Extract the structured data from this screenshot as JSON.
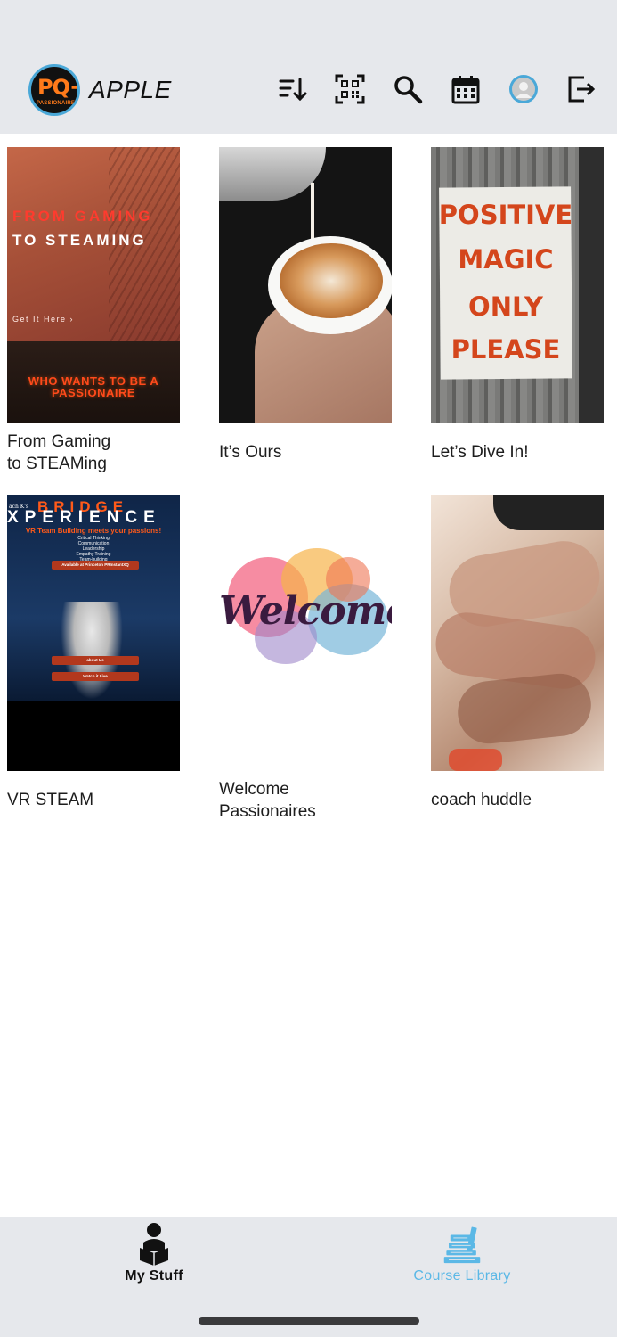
{
  "header": {
    "logo_text": "PQ+",
    "logo_subtext": "PASSIONAIRE",
    "brand": "APPLE",
    "actions": [
      {
        "name": "sort",
        "icon": "sort-descending-icon"
      },
      {
        "name": "qr",
        "icon": "qr-code-icon"
      },
      {
        "name": "search",
        "icon": "search-icon"
      },
      {
        "name": "calendar",
        "icon": "calendar-icon"
      },
      {
        "name": "profile",
        "icon": "avatar"
      },
      {
        "name": "logout",
        "icon": "logout-icon"
      }
    ]
  },
  "courses": [
    {
      "title": "From Gaming\nto STEAMing",
      "thumb": {
        "line1": "FROM GAMING",
        "line2": "TO STEAMING",
        "cta": "Get It Here ›",
        "banner": "WHO WANTS TO BE A PASSIONAIRE"
      }
    },
    {
      "title": "It’s Ours"
    },
    {
      "title": "Let’s Dive In!",
      "thumb": {
        "w1": "POSITIVE",
        "w2": "MAGIC",
        "w3": "ONLY",
        "w4": "PLEASE"
      }
    },
    {
      "title": "VR STEAM",
      "thumb": {
        "coach": "ach K's",
        "bridge": "BRIDGE",
        "experience": "XPERIENCE",
        "tagline": "VR Team Building meets your passions!",
        "skills": "Critical Thinking\nCommunication\nLeadership\nEmpathy Training\nTeam-building",
        "btn1": "Available at Princeton PRInstantXQ",
        "btn2": "about Us",
        "btn3": "Watch it Live"
      }
    },
    {
      "title": "Welcome\nPassionaires",
      "thumb": {
        "word": "Welcome"
      }
    },
    {
      "title": "coach huddle"
    }
  ],
  "tabbar": {
    "items": [
      {
        "label": "My Stuff",
        "icon": "reading-person-icon",
        "active": false
      },
      {
        "label": "Course Library",
        "icon": "books-icon",
        "active": true
      }
    ]
  },
  "colors": {
    "header_bg": "#e6e8ec",
    "accent": "#5bb8e6",
    "logo_ring": "#4aa8d8",
    "logo_orange": "#ff7a1a"
  }
}
